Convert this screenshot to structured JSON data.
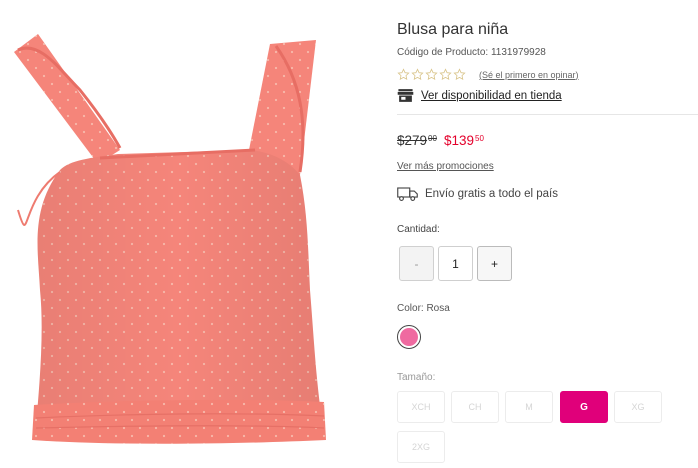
{
  "product": {
    "title": "Blusa para niña",
    "sku_label": "Código de Producto: 1131979928",
    "image_icon": "pink-ruffle-blouse-image"
  },
  "rating": {
    "stars": 0,
    "max_stars": 5,
    "review_link": "(Sé el primero en opinar)"
  },
  "store": {
    "icon": "store-icon",
    "link": "Ver disponibilidad en tienda"
  },
  "price": {
    "old_main": "$279",
    "old_cents": "00",
    "new_main": "$139",
    "new_cents": "50",
    "promo_link": "Ver más promociones"
  },
  "shipping": {
    "icon": "truck-icon",
    "text": "Envío gratis a todo el país"
  },
  "quantity": {
    "label": "Cantidad:",
    "minus": "-",
    "value": "1",
    "plus": "+"
  },
  "color": {
    "label": "Color: Rosa",
    "swatch_hex": "#ef6aa0"
  },
  "size": {
    "label": "Tamaño:",
    "options": [
      "XCH",
      "CH",
      "M",
      "G",
      "XG",
      "2XG"
    ],
    "selected": "G"
  },
  "colors": {
    "accent": "#e0007a",
    "sale_price": "#e4002b"
  }
}
